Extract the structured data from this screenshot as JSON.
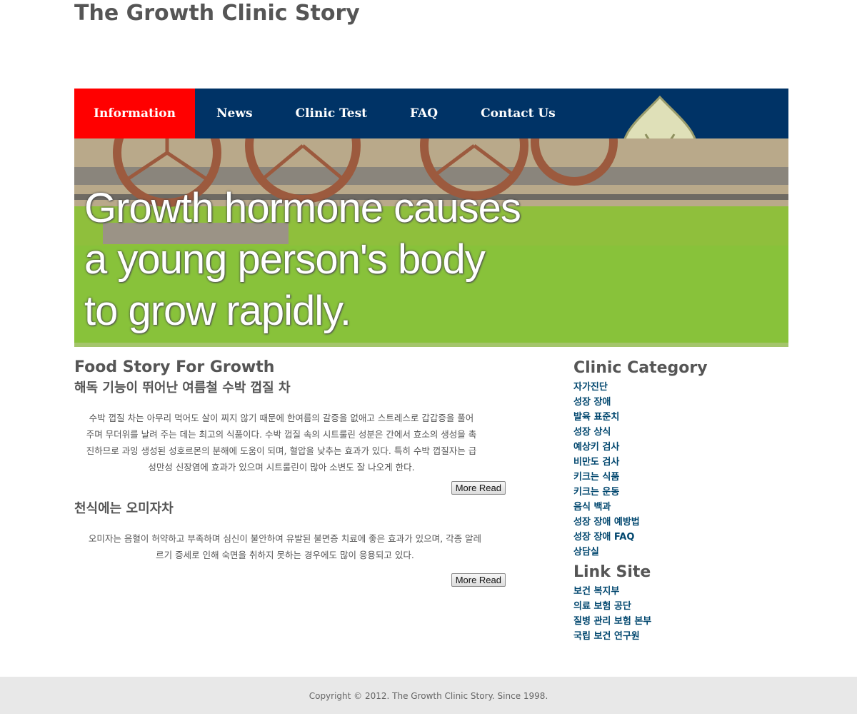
{
  "site": {
    "title": "The Growth Clinic Story"
  },
  "nav": {
    "items": [
      {
        "label": "Information",
        "active": true
      },
      {
        "label": "News"
      },
      {
        "label": "Clinic Test"
      },
      {
        "label": "FAQ"
      },
      {
        "label": "Contact Us"
      }
    ]
  },
  "hero": {
    "text": "Growth hormone causes\na young person's body\nto grow rapidly."
  },
  "main": {
    "section_title": "Food Story For Growth",
    "articles": [
      {
        "title": "해독 기능이 뛰어난 여름철 수박 껍질 차",
        "body": "수박 껍질 차는 아무리 먹어도 살이 찌지 않기 때문에 한여름의 갈증을 없애고 스트레스로 갑갑증을 풀어주며 무더위를 날려 주는 데는 최고의 식품이다. 수박 껍질 속의 시트룰린 성분은 간에서 효소의 생성을 촉진하므로 과잉 생성된 성호르몬의 분해에 도움이 되며, 혈압을 낮추는 효과가 있다. 특히 수박 껍질자는 급성만성 신장염에 효과가 있으며 시트룰린이 많아 소변도 잘 나오게 한다.",
        "more": "More Read"
      },
      {
        "title": "천식에는 오미자차",
        "body": "오미자는 음혈이 허약하고 부족하며 심신이 불안하여 유발된 불면증 치료에 좋은 효과가 있으며, 각종 알레르기 증세로 인해 숙면을 취하지 못하는 경우에도 많이 응용되고 있다.",
        "more": "More Read"
      }
    ]
  },
  "sidebar": {
    "category_title": "Clinic Category",
    "categories": [
      "자가진단",
      "성장 장애",
      "발육 표준치",
      "성장 상식",
      "예상키 검사",
      "비만도 검사",
      "키크는 식품",
      "키크는 운동",
      "음식 백과",
      "성장 장애 예방법",
      "성장 장애 FAQ",
      "상담실"
    ],
    "link_title": "Link Site",
    "links": [
      "보건 복지부",
      "의료 보험 공단",
      "질병 관리 보험 본부",
      "국립 보건 연구원"
    ]
  },
  "footer": {
    "text": "Copyright © 2012. The Growth Clinic Story. Since 1998."
  },
  "colors": {
    "nav_bg": "#003366",
    "nav_active": "#ff0000",
    "link": "#00466e",
    "footer_bg": "#e8e8e8"
  }
}
